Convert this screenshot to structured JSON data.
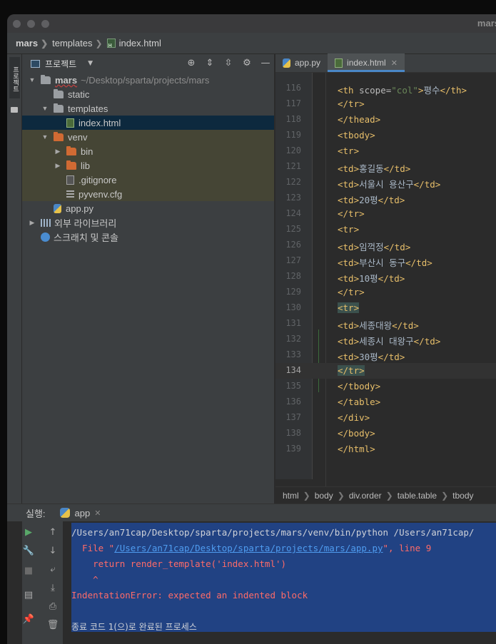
{
  "window": {
    "title": "mars"
  },
  "breadcrumb": [
    "mars",
    "templates",
    "index.html"
  ],
  "left_strip": {
    "tab_label": "프로젝트"
  },
  "project": {
    "label": "프로젝트",
    "tree": [
      {
        "name": "mars",
        "path": "~/Desktop/sparta/projects/mars",
        "type": "folder-gray",
        "indent": 0,
        "arrow": "open"
      },
      {
        "name": "static",
        "type": "folder-gray",
        "indent": 1,
        "arrow": ""
      },
      {
        "name": "templates",
        "type": "folder-gray",
        "indent": 1,
        "arrow": "open"
      },
      {
        "name": "index.html",
        "type": "html",
        "indent": 2,
        "arrow": "",
        "selected": true
      },
      {
        "name": "venv",
        "type": "folder-orange",
        "indent": 1,
        "arrow": "open",
        "venv": true
      },
      {
        "name": "bin",
        "type": "folder-orange",
        "indent": 2,
        "arrow": "closed",
        "venv": true
      },
      {
        "name": "lib",
        "type": "folder-orange",
        "indent": 2,
        "arrow": "closed",
        "venv": true
      },
      {
        "name": ".gitignore",
        "type": "git",
        "indent": 2,
        "arrow": "",
        "venv": true
      },
      {
        "name": "pyvenv.cfg",
        "type": "cfg",
        "indent": 2,
        "arrow": "",
        "venv": true
      },
      {
        "name": "app.py",
        "type": "py",
        "indent": 1,
        "arrow": ""
      },
      {
        "name": "외부 라이브러리",
        "type": "lib",
        "indent": 0,
        "arrow": "closed"
      },
      {
        "name": "스크래치 및 콘솔",
        "type": "scratch",
        "indent": 0,
        "arrow": ""
      }
    ]
  },
  "editor": {
    "tabs": [
      {
        "label": "app.py",
        "active": false
      },
      {
        "label": "index.html",
        "active": true
      }
    ],
    "lines": [
      {
        "n": "116",
        "parts": [
          [
            "tag",
            "<th "
          ],
          [
            "attr",
            "scope="
          ],
          [
            "str",
            "\"col\""
          ],
          [
            "tag",
            ">"
          ],
          [
            "txt",
            "평수"
          ],
          [
            "tag",
            "</th>"
          ]
        ]
      },
      {
        "n": "117",
        "parts": [
          [
            "tag",
            "</tr>"
          ]
        ],
        "indent": -1
      },
      {
        "n": "118",
        "parts": [
          [
            "tag",
            "</thead>"
          ]
        ],
        "indent": -1
      },
      {
        "n": "119",
        "parts": [
          [
            "tag",
            "<tbody>"
          ]
        ],
        "indent": -1
      },
      {
        "n": "120",
        "parts": [
          [
            "tag",
            "<tr>"
          ]
        ]
      },
      {
        "n": "121",
        "parts": [
          [
            "tag",
            "<td>"
          ],
          [
            "txt",
            "홍길동"
          ],
          [
            "tag",
            "</td>"
          ]
        ]
      },
      {
        "n": "122",
        "parts": [
          [
            "tag",
            "<td>"
          ],
          [
            "txt",
            "서울시 용산구"
          ],
          [
            "tag",
            "</td>"
          ]
        ]
      },
      {
        "n": "123",
        "parts": [
          [
            "tag",
            "<td>"
          ],
          [
            "txt",
            "20평"
          ],
          [
            "tag",
            "</td>"
          ]
        ]
      },
      {
        "n": "124",
        "parts": [
          [
            "tag",
            "</tr>"
          ]
        ]
      },
      {
        "n": "125",
        "parts": [
          [
            "tag",
            "<tr>"
          ]
        ]
      },
      {
        "n": "126",
        "parts": [
          [
            "tag",
            "<td>"
          ],
          [
            "txt",
            "임꺽정"
          ],
          [
            "tag",
            "</td>"
          ]
        ]
      },
      {
        "n": "127",
        "parts": [
          [
            "tag",
            "<td>"
          ],
          [
            "txt",
            "부산시 동구"
          ],
          [
            "tag",
            "</td>"
          ]
        ]
      },
      {
        "n": "128",
        "parts": [
          [
            "tag",
            "<td>"
          ],
          [
            "txt",
            "10평"
          ],
          [
            "tag",
            "</td>"
          ]
        ]
      },
      {
        "n": "129",
        "parts": [
          [
            "tag",
            "</tr>"
          ]
        ]
      },
      {
        "n": "130",
        "parts": [
          [
            "tag",
            "<tr>"
          ]
        ],
        "hl": true
      },
      {
        "n": "131",
        "parts": [
          [
            "tag",
            "<td>"
          ],
          [
            "txt",
            "세종대왕"
          ],
          [
            "tag",
            "</td>"
          ]
        ]
      },
      {
        "n": "132",
        "parts": [
          [
            "tag",
            "<td>"
          ],
          [
            "txt",
            "세종시 대왕구"
          ],
          [
            "tag",
            "</td>"
          ]
        ]
      },
      {
        "n": "133",
        "parts": [
          [
            "tag",
            "<td>"
          ],
          [
            "txt",
            "30평"
          ],
          [
            "tag",
            "</td>"
          ]
        ]
      },
      {
        "n": "134",
        "parts": [
          [
            "tag",
            "</tr>"
          ]
        ],
        "hl": true,
        "current": true
      },
      {
        "n": "135",
        "parts": [
          [
            "tag",
            "</tbody>"
          ]
        ]
      },
      {
        "n": "136",
        "parts": [
          [
            "tag",
            "</table>"
          ]
        ]
      },
      {
        "n": "137",
        "parts": [
          [
            "tag",
            "</div>"
          ]
        ]
      },
      {
        "n": "138",
        "parts": [
          [
            "tag",
            "</body>"
          ]
        ]
      },
      {
        "n": "139",
        "parts": [
          [
            "tag",
            "</html>"
          ]
        ]
      }
    ],
    "status_crumbs": [
      "html",
      "body",
      "div.order",
      "table.table",
      "tbody"
    ]
  },
  "run": {
    "label": "실행:",
    "tab": "app",
    "console": {
      "line1": "/Users/an71cap/Desktop/sparta/projects/mars/venv/bin/python /Users/an71cap/",
      "file_prefix": "  File \"",
      "file_link": "/Users/an71cap/Desktop/sparta/projects/mars/app.py",
      "file_suffix": "\", line 9",
      "code_line": "    return render_template('index.html')",
      "caret_line": "    ^",
      "error_line": "IndentationError: expected an indented block",
      "exit_line": "종료 코드 1(으)로 완료된 프로세스"
    }
  },
  "colors": {
    "accent": "#4a88c7",
    "console_bg": "#214283",
    "error": "#ff6b68",
    "tag": "#e8bf6a",
    "string": "#6a8759"
  }
}
